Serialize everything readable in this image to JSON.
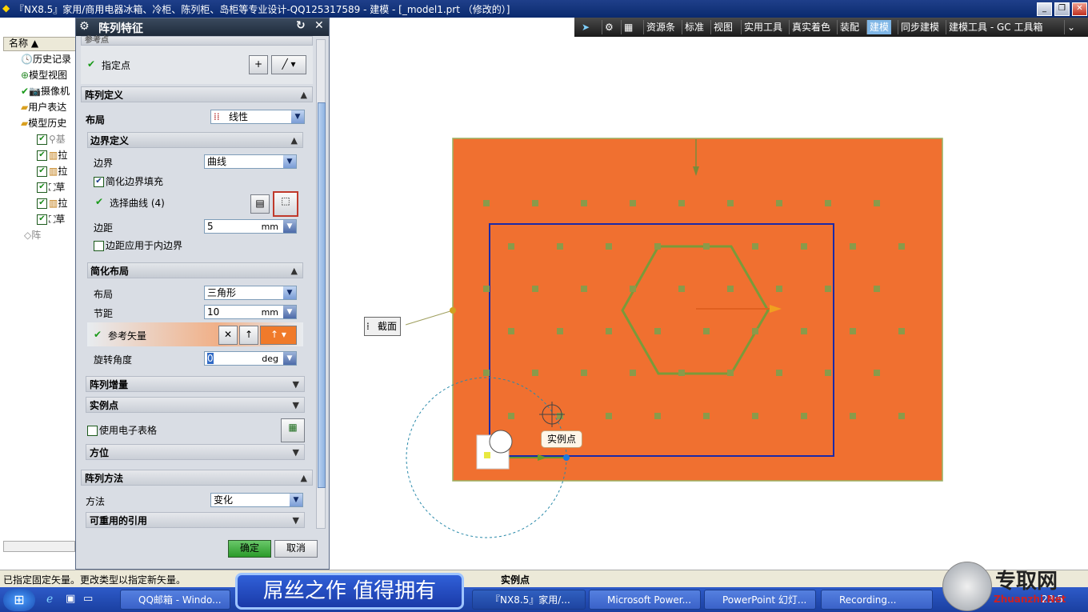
{
  "window": {
    "title": "『NX8.5』家用/商用电器冰箱、冷柜、陈列柜、岛柜等专业设计-QQ125317589 - 建模 - [_model1.prt （修改的）]"
  },
  "toolbar": {
    "items": [
      "资源条",
      "标准",
      "视图",
      "实用工具",
      "真实着色",
      "装配",
      "建模",
      "同步建模",
      "建模工具 - GC 工具箱"
    ],
    "active": "建模"
  },
  "navigator": {
    "header": "名称",
    "items": [
      "历史记录",
      "模型视图",
      "摄像机",
      "用户表达",
      "模型历史",
      "基",
      "拉",
      "拉",
      "草",
      "拉",
      "草",
      "阵"
    ]
  },
  "dialog": {
    "title": "阵列特征",
    "ref_point_header": "参考点",
    "specify_point": "指定点",
    "array_def": "阵列定义",
    "layout_label": "布局",
    "layout_value": "线性",
    "boundary_def": "边界定义",
    "boundary_label": "边界",
    "boundary_value": "曲线",
    "simplify_fill": "简化边界填充",
    "select_curve": "选择曲线 (4)",
    "margin_label": "边距",
    "margin_value": "5",
    "margin_unit": "mm",
    "margin_inner": "边距应用于内边界",
    "simple_layout": "简化布局",
    "layout2_label": "布局",
    "layout2_value": "三角形",
    "pitch_label": "节距",
    "pitch_value": "10",
    "pitch_unit": "mm",
    "ref_vector": "参考矢量",
    "rotate_label": "旋转角度",
    "rotate_value": "0",
    "rotate_unit": "deg",
    "array_incr": "阵列增量",
    "instance_point": "实例点",
    "use_spreadsheet": "使用电子表格",
    "orientation": "方位",
    "array_method": "阵列方法",
    "method_label": "方法",
    "method_value": "变化",
    "reusable_ref": "可重用的引用",
    "ok": "确定",
    "cancel": "取消"
  },
  "viewport": {
    "section_label": "截面",
    "instance_tooltip": "实例点"
  },
  "status": {
    "left": "已指定固定矢量。更改类型以指定新矢量。",
    "right": "实例点"
  },
  "banner": "屌丝之作  值得拥有",
  "taskbar": {
    "items": [
      "QQ邮箱 - Windo...",
      "『NX8.5』家用/...",
      "Microsoft Power...",
      "PowerPoint 幻灯...",
      "Recording..."
    ],
    "clock": "23:5"
  },
  "watermark": {
    "text": "专取网",
    "url": "Zhuanzhi.Net"
  },
  "colors": {
    "plate": "#f07030",
    "boundary": "#1a2aa8",
    "hexagon": "#7a9a3a",
    "dots": "#8a9a4a"
  }
}
